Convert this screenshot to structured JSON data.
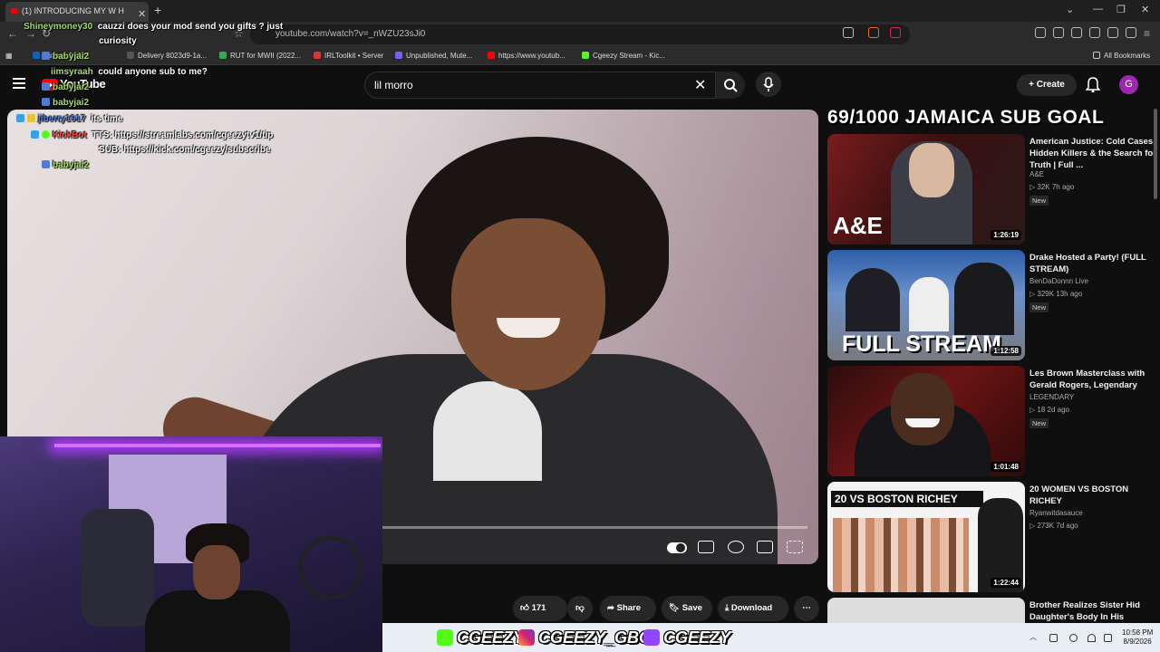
{
  "browser": {
    "tab_title": "(1) INTRODUCING MY W H",
    "url": "youtube.com/watch?v=_nWZU23sJi0",
    "bookmarks": [
      "outlook 20023",
      "Delivery 8023d9-1a...",
      "RUT for MWII (2022...",
      "IRLToolkit • Server",
      "Unpublished, Mute...",
      "https://www.youtub...",
      "Cgeezy Stream - Kic..."
    ],
    "all_bookmarks": "All Bookmarks"
  },
  "youtube": {
    "logo": "YouTube",
    "search_value": "lil morro",
    "create_label": "Create",
    "avatar_letter": "G"
  },
  "chat": [
    {
      "user": "Shineymoney30",
      "message": "cauzzi does your mod send you gifts ? just"
    },
    {
      "user": "",
      "message": "curiosity"
    },
    {
      "user": "babyjai2",
      "message": ""
    },
    {
      "user": "iimsyraah",
      "message": "could anyone sub to me?"
    },
    {
      "user": "babyjai2",
      "message": ""
    },
    {
      "user": "babyjai2",
      "message": ""
    },
    {
      "user": "jiberry1917",
      "message": "its time"
    },
    {
      "user": "KickBot",
      "message": "TTS: https://streamlabs.com/cgeezytv1/tip"
    },
    {
      "user": "",
      "message": "SUB: https://kick.com/cgeezy/subscribe"
    },
    {
      "user": "babyjai2",
      "message": ""
    }
  ],
  "banner": "69/1000 JAMAICA SUB GOAL",
  "recommendations": [
    {
      "title": "American Justice: Cold Cases, Hidden Killers & the Search for Truth | Full ...",
      "channel": "A&E",
      "meta": "32K  7h ago",
      "badge": "New",
      "duration": "1:26:19",
      "thumb_text": "A&E"
    },
    {
      "title": "Drake Hosted a Party! (FULL STREAM)",
      "channel": "BenDaDonnn Live",
      "meta": "329K  13h ago",
      "badge": "New",
      "duration": "1:12:58",
      "thumb_text": "FULL STREAM"
    },
    {
      "title": "Les Brown Masterclass with Gerald Rogers, Legendary",
      "channel": "LEGENDARY",
      "meta": "18  2d ago",
      "badge": "New",
      "duration": "1:01:48",
      "thumb_text": ""
    },
    {
      "title": "20 WOMEN VS BOSTON RICHEY",
      "channel": "Ryanwitdasauce",
      "meta": "273K  7d ago",
      "badge": "",
      "duration": "1:22:44",
      "thumb_text": "20 VS BOSTON RICHEY"
    },
    {
      "title": "Brother Realizes Sister Hid Daughter's Body In His",
      "channel": "",
      "meta": "",
      "badge": "",
      "duration": "",
      "thumb_text": ""
    }
  ],
  "actions": {
    "like_count": "171",
    "share": "Share",
    "save": "Save",
    "download": "Download"
  },
  "socials": [
    "CGEEZY",
    "CGEEZY_GBC",
    "CGEEZY"
  ],
  "clock": {
    "time": "10:58 PM",
    "date": "8/9/2026"
  },
  "colors": {
    "accent_red": "#ff0000",
    "chat_user": "#a6d96a",
    "kickbot": "#ff4d4d",
    "avatar": "#9c27b0"
  }
}
